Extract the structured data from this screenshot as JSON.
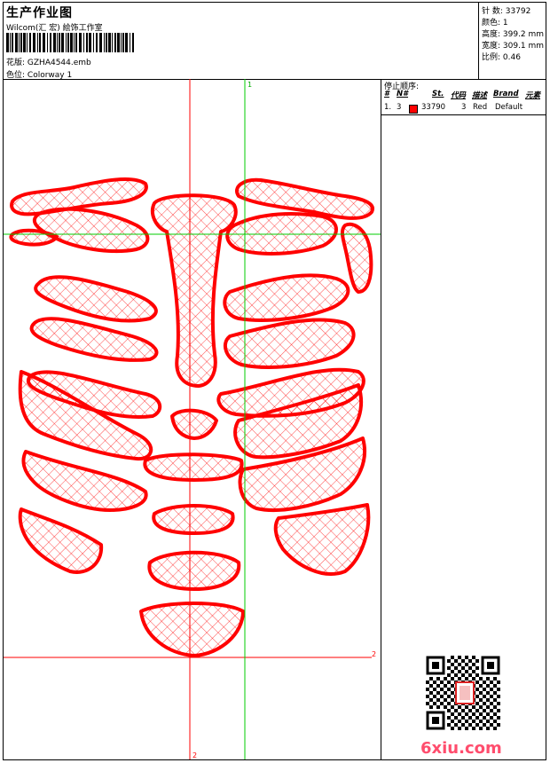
{
  "header": {
    "title": "生产作业图",
    "company": "Wilcom(汇 宏) 絵饰工作室",
    "design_label": "花版: ",
    "design_value": "GZHA4544.emb",
    "colorway_label": "色位: ",
    "colorway_value": "Colorway 1"
  },
  "info": {
    "stitches": "针 数: 33792",
    "colors": "颜色: 1",
    "height": "高度: 399.2 mm",
    "width": "宽度: 309.1 mm",
    "scale": "比例: 0.46"
  },
  "stop_sequence": {
    "title": "停止顺序:",
    "columns": [
      "#",
      "N#",
      "St.",
      "代码",
      "描述",
      "Brand",
      "元素"
    ],
    "rows": [
      {
        "index": "1.",
        "needle": "3",
        "stitches": "33790",
        "code": "3",
        "description": "Red",
        "brand": "Default",
        "color": "#ff0000"
      }
    ]
  },
  "guides": {
    "top_marker": "1",
    "right_marker": "2",
    "bottom_marker": "2"
  },
  "watermark": "6xiu.com",
  "colors": {
    "thread": "#ff0000",
    "guide_green": "#00cc00",
    "guide_red": "#ff0000"
  },
  "icons": {
    "barcode": "barcode-icon",
    "qr": "qr-code-icon",
    "stamp": "red-seal-stamp"
  }
}
